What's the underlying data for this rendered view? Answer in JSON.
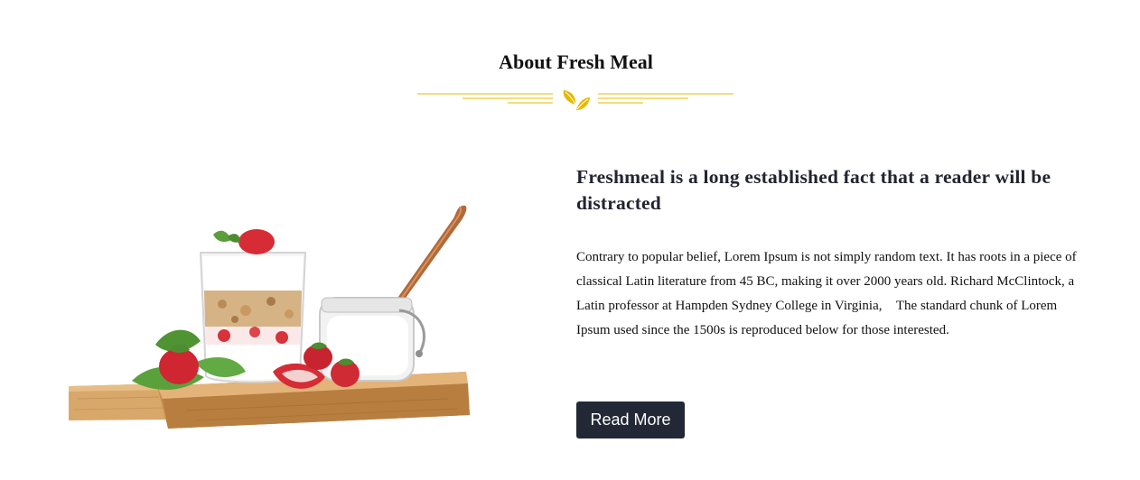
{
  "section": {
    "title": "About Fresh Meal"
  },
  "about": {
    "heading": "Freshmeal is a long established fact that a reader will be distracted",
    "body": "Contrary to popular belief, Lorem Ipsum is not simply random text. It has roots in a piece of classical Latin literature from 45 BC, making it over 2000 years old. Richard McClintock, a Latin professor at Hampden Sydney College in Virginia, \u0000The standard chunk of Lorem Ipsum used since the 1500s is reproduced below for those interested.",
    "button_label": "Read More"
  },
  "colors": {
    "accent_gold": "#e6b800",
    "button_bg": "#222835",
    "heading_text": "#222530"
  },
  "icons": {
    "divider_icon": "leaf-icon"
  }
}
